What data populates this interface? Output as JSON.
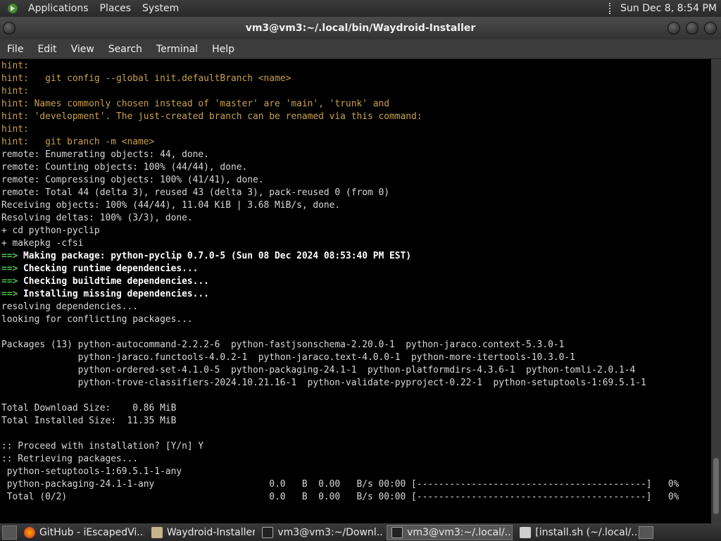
{
  "top_panel": {
    "menus": [
      "Applications",
      "Places",
      "System"
    ],
    "clock": "Sun Dec  8,  8:54 PM"
  },
  "window": {
    "title": "vm3@vm3:~/.local/bin/Waydroid-Installer"
  },
  "menubar": [
    "File",
    "Edit",
    "View",
    "Search",
    "Terminal",
    "Help"
  ],
  "terminal": {
    "lines": [
      {
        "style": "hint",
        "text": "hint:"
      },
      {
        "style": "hint",
        "text": "hint:   git config --global init.defaultBranch <name>"
      },
      {
        "style": "hint",
        "text": "hint:"
      },
      {
        "style": "hint",
        "text": "hint: Names commonly chosen instead of 'master' are 'main', 'trunk' and"
      },
      {
        "style": "hint",
        "text": "hint: 'development'. The just-created branch can be renamed via this command:"
      },
      {
        "style": "hint",
        "text": "hint:"
      },
      {
        "style": "hint",
        "text": "hint:   git branch -m <name>"
      },
      {
        "style": "plain",
        "text": "remote: Enumerating objects: 44, done."
      },
      {
        "style": "plain",
        "text": "remote: Counting objects: 100% (44/44), done."
      },
      {
        "style": "plain",
        "text": "remote: Compressing objects: 100% (41/41), done."
      },
      {
        "style": "plain",
        "text": "remote: Total 44 (delta 3), reused 43 (delta 3), pack-reused 0 (from 0)"
      },
      {
        "style": "plain",
        "text": "Receiving objects: 100% (44/44), 11.04 KiB | 3.68 MiB/s, done."
      },
      {
        "style": "plain",
        "text": "Resolving deltas: 100% (3/3), done."
      },
      {
        "style": "plain",
        "text": "+ cd python-pyclip"
      },
      {
        "style": "plain",
        "text": "+ makepkg -cfsi"
      },
      {
        "style": "arrow",
        "prefix": "==> ",
        "text": "Making package: python-pyclip 0.7.0-5 (Sun 08 Dec 2024 08:53:40 PM EST)"
      },
      {
        "style": "arrow",
        "prefix": "==> ",
        "text": "Checking runtime dependencies..."
      },
      {
        "style": "arrow",
        "prefix": "==> ",
        "text": "Checking buildtime dependencies..."
      },
      {
        "style": "arrow",
        "prefix": "==> ",
        "text": "Installing missing dependencies..."
      },
      {
        "style": "plain",
        "text": "resolving dependencies..."
      },
      {
        "style": "plain",
        "text": "looking for conflicting packages..."
      },
      {
        "style": "plain",
        "text": ""
      },
      {
        "style": "plain",
        "text": "Packages (13) python-autocommand-2.2.2-6  python-fastjsonschema-2.20.0-1  python-jaraco.context-5.3.0-1"
      },
      {
        "style": "plain",
        "text": "              python-jaraco.functools-4.0.2-1  python-jaraco.text-4.0.0-1  python-more-itertools-10.3.0-1"
      },
      {
        "style": "plain",
        "text": "              python-ordered-set-4.1.0-5  python-packaging-24.1-1  python-platformdirs-4.3.6-1  python-tomli-2.0.1-4"
      },
      {
        "style": "plain",
        "text": "              python-trove-classifiers-2024.10.21.16-1  python-validate-pyproject-0.22-1  python-setuptools-1:69.5.1-1"
      },
      {
        "style": "plain",
        "text": ""
      },
      {
        "style": "plain",
        "text": "Total Download Size:    0.86 MiB"
      },
      {
        "style": "plain",
        "text": "Total Installed Size:  11.35 MiB"
      },
      {
        "style": "plain",
        "text": ""
      },
      {
        "style": "plain",
        "text": ":: Proceed with installation? [Y/n] Y"
      },
      {
        "style": "plain",
        "text": ":: Retrieving packages..."
      },
      {
        "style": "plain",
        "text": " python-setuptools-1:69.5.1-1-any"
      },
      {
        "style": "plain",
        "text": " python-packaging-24.1-1-any                     0.0   B  0.00   B/s 00:00 [------------------------------------------]   0%"
      },
      {
        "style": "plain",
        "text": " Total (0/2)                                     0.0   B  0.00   B/s 00:00 [------------------------------------------]   0%"
      }
    ]
  },
  "taskbar": {
    "tasks": [
      {
        "icon": "firefox-icon",
        "label": "GitHub - iEscapedVi...",
        "active": false
      },
      {
        "icon": "folder-icon",
        "label": "Waydroid-Installer",
        "active": false
      },
      {
        "icon": "terminal-icon",
        "label": "vm3@vm3:~/Downl...",
        "active": false
      },
      {
        "icon": "terminal-icon",
        "label": "vm3@vm3:~/.local/...",
        "active": true
      },
      {
        "icon": "text-editor-icon",
        "label": "[install.sh (~/.local/...",
        "active": false
      }
    ]
  }
}
